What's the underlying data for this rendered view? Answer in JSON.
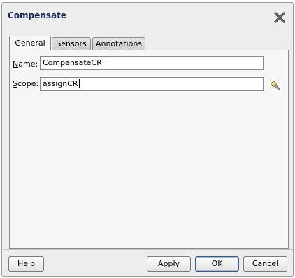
{
  "dialog": {
    "title": "Compensate",
    "close_icon": "close-icon"
  },
  "tabs": [
    {
      "label": "General",
      "active": true
    },
    {
      "label": "Sensors",
      "active": false
    },
    {
      "label": "Annotations",
      "active": false
    }
  ],
  "general": {
    "name_label_mnemonic": "N",
    "name_label_rest": "ame:",
    "name_value": "CompensateCR",
    "scope_label_mnemonic": "S",
    "scope_label_rest": "cope:",
    "scope_value": "assignCR",
    "scope_browse_icon": "flashlight-icon"
  },
  "buttons": {
    "help_mnemonic": "H",
    "help_rest": "elp",
    "apply_mnemonic": "A",
    "apply_rest": "pply",
    "ok_label": "OK",
    "cancel_label": "Cancel"
  }
}
